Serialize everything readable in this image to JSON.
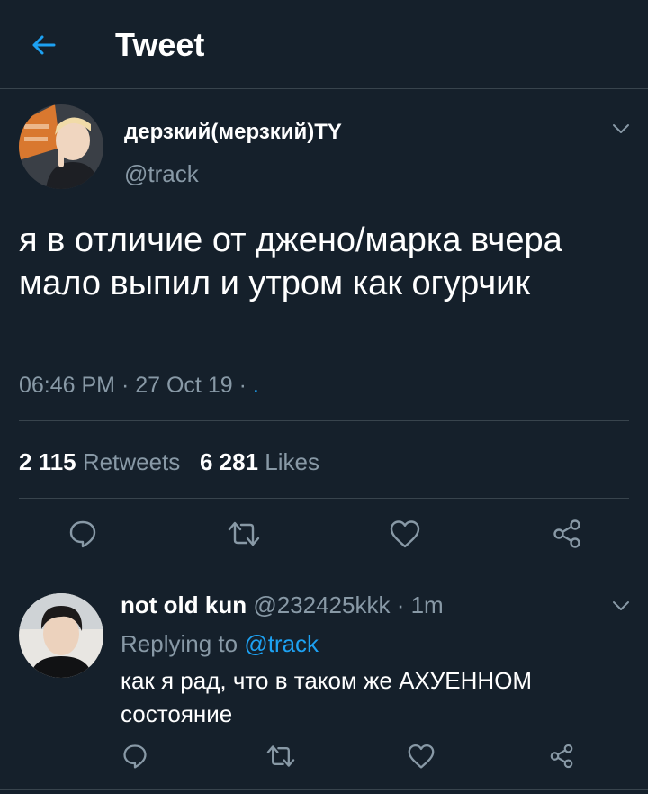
{
  "header": {
    "title": "Tweet",
    "back_icon": "arrow-left-icon"
  },
  "tweet": {
    "display_name": "дерзкий(мерзкий)TY",
    "handle": "@track",
    "text": "я в отличие от джено/марка вчера мало выпил и утром как огурчик",
    "time": "06:46 PM",
    "sep1": " · ",
    "date": "27 Oct 19",
    "sep2": " · ",
    "source": ".",
    "retweets_count": "2 115",
    "retweets_label": "Retweets",
    "likes_count": "6 281",
    "likes_label": "Likes"
  },
  "reply": {
    "display_name": "not old kun",
    "handle": "@232425kkk",
    "sep": " · ",
    "time": "1m",
    "replying_prefix": "Replying to ",
    "replying_to": "@track",
    "text": "как я рад, что в таком же АХУЕННОМ состояние"
  },
  "colors": {
    "background": "#15202b",
    "accent": "#1da1f2",
    "muted": "#8899a6",
    "divider": "#38444d",
    "text": "#ffffff"
  }
}
